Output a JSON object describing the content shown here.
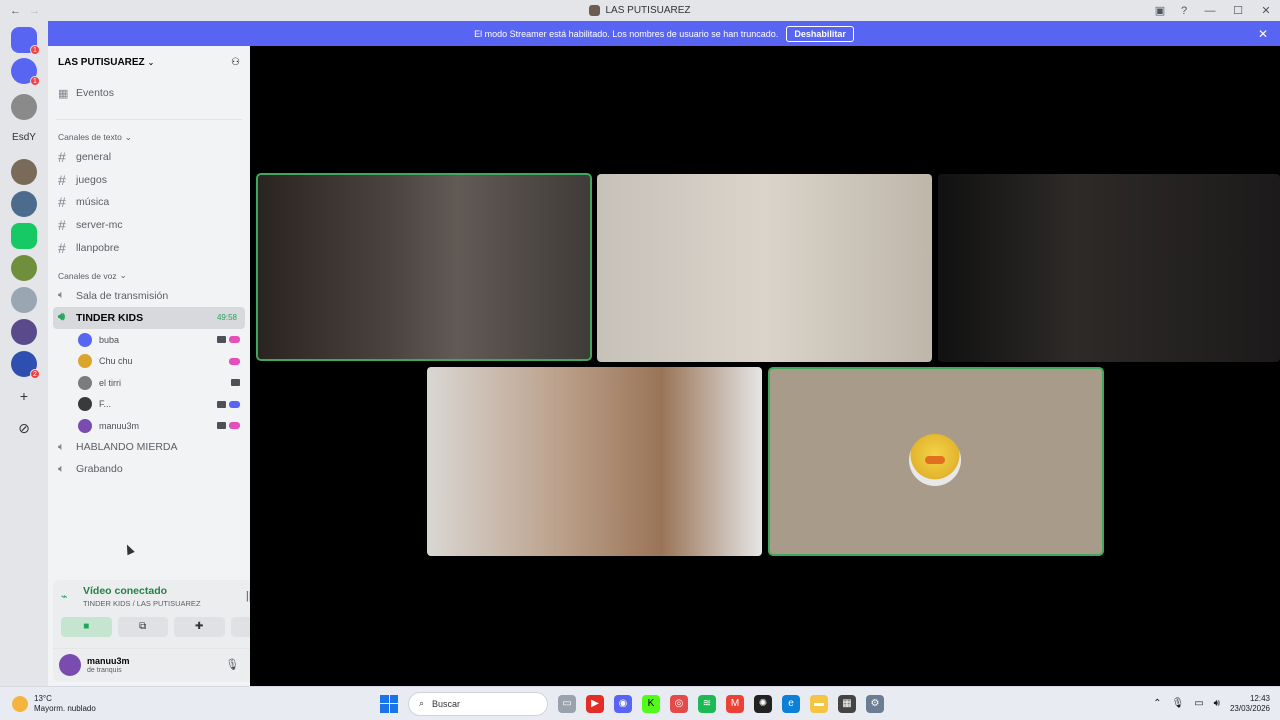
{
  "window": {
    "title": "LAS PUTISUAREZ",
    "back_icon": "←",
    "forward_icon": "→"
  },
  "banner": {
    "message": "El modo Streamer está habilitado. Los nombres de usuario se han truncado.",
    "button_label": "Deshabilitar",
    "close_icon": "✕",
    "color": "#5865f2"
  },
  "rail": {
    "items": [
      {
        "name": "discord-home",
        "badge": "1",
        "color": "#5865f2"
      },
      {
        "name": "server-1",
        "badge": "1",
        "color": "#5865f2"
      },
      {
        "name": "server-2",
        "color": "#8a8a8a"
      },
      {
        "name": "EsdY",
        "text": "EsdY"
      },
      {
        "name": "server-3",
        "color": "#7a6a5a"
      },
      {
        "name": "server-4",
        "color": "#4d6b8c"
      },
      {
        "name": "server-5",
        "color": "#17c964"
      },
      {
        "name": "server-6",
        "color": "#6f8f3c"
      },
      {
        "name": "server-7",
        "color": "#9aa6b2"
      },
      {
        "name": "server-8",
        "color": "#5a4a8c"
      },
      {
        "name": "server-9",
        "badge": "2",
        "color": "#2f4fb0"
      }
    ]
  },
  "sidebar": {
    "guild_name": "LAS PUTISUAREZ",
    "events_label": "Eventos",
    "text_category": "Canales de texto",
    "text_channels": [
      "general",
      "juegos",
      "música",
      "server-mc",
      "llanpobre"
    ],
    "voice_category": "Canales de voz",
    "voice_channels": {
      "broadcast": "Sala de transmisión",
      "active": "TINDER KIDS",
      "active_timer": "49:58",
      "others": [
        "HABLANDO MIERDA",
        "Grabando"
      ]
    },
    "voice_users": [
      {
        "name": "buba",
        "cam": true,
        "game": "#e64fb8",
        "avatar": "#5865f2"
      },
      {
        "name": "Chu chu",
        "cam": false,
        "game": "#e64fb8",
        "avatar": "#d9a52c"
      },
      {
        "name": "el tirri",
        "cam": true,
        "game": "",
        "avatar": "#7c7c7c"
      },
      {
        "name": "F...",
        "cam": true,
        "game": "#5865f2",
        "avatar": "#3a3a3a"
      },
      {
        "name": "manuu3m",
        "cam": true,
        "game": "#e64fb8",
        "avatar": "#7a4cb0"
      }
    ]
  },
  "voice_panel": {
    "status": "Vídeo conectado",
    "location": "TINDER KIDS / LAS PUTISUAREZ",
    "buttons": [
      "camera-icon",
      "screen-share-icon",
      "activities-icon",
      "soundboard-icon"
    ],
    "user": {
      "name": "manuu3m",
      "status": "de tranquis"
    }
  },
  "taskbar": {
    "weather_temp": "13°C",
    "weather_desc": "Mayorm. nublado",
    "search_placeholder": "Buscar",
    "time": "12:43",
    "date": "23/03/2026"
  }
}
